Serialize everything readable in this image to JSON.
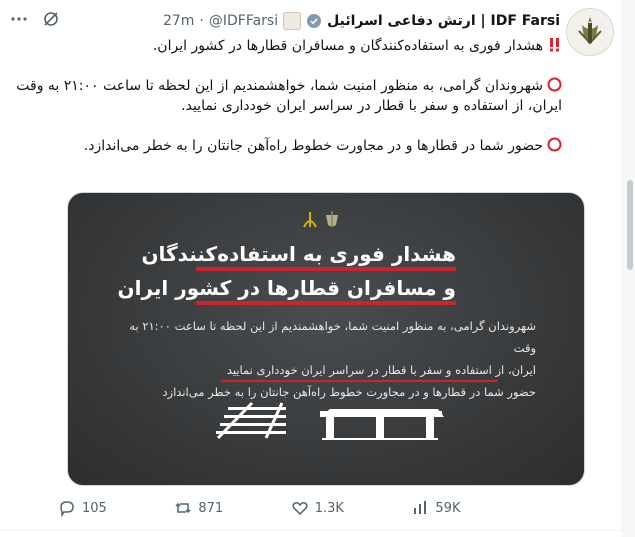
{
  "tweet": {
    "display_name": "ارتش دفاعی اسرائیل | IDF Farsi",
    "handle": "@IDFFarsi",
    "separator": "·",
    "time": "27m",
    "paragraphs": [
      "هشدار فوری به استفاده‌کنندگان و مسافران قطارها در کشور ایران.",
      "شهروندان گرامی، به منظور امنیت شما، خواهشمندیم از این لحظه تا ساعت ۲۱:۰۰ به وقت ایران، از استفاده و سفر با قطار در سراسر ایران خودداری نمایید.",
      "حضور شما در قطارها و در مجاورت خطوط راه‌آهن جانتان را به خطر می‌اندازد."
    ],
    "media": {
      "headline_line1": "هشدار فوری به استفاده‌کنندگان",
      "headline_line2": "و مسافران قطارها در کشور ایران",
      "body_line1": "شهروندان گرامی، به منظور امنیت شما، خواهشمندیم از این لحظه تا ساعت ۲۱:۰۰ به وقت",
      "body_line2": "ایران، از استفاده و سفر با قطار در سراسر ایران خودداری نمایید",
      "body_line3": "حضور شما در قطارها و در مجاورت خطوط راه‌آهن جانتان را به خطر می‌اندازد"
    },
    "metrics": {
      "replies": "105",
      "reposts": "871",
      "likes": "1.3K",
      "views": "59K"
    }
  },
  "colors": {
    "accent_red": "#d0222a",
    "media_bg": "#3a3c3e",
    "muted": "#536471"
  }
}
